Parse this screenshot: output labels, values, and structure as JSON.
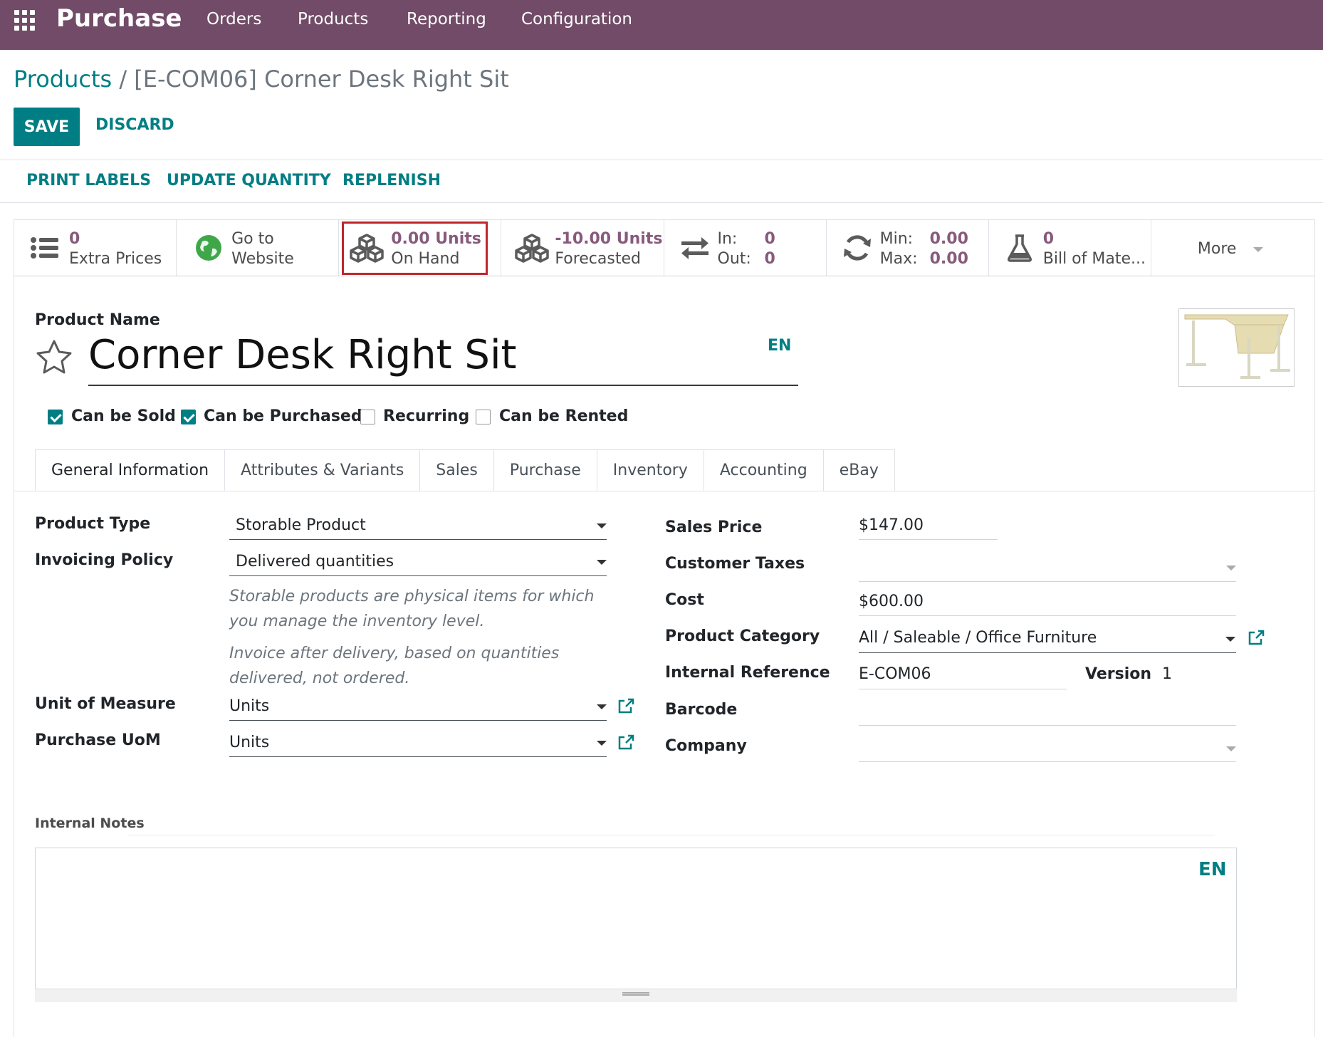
{
  "navbar": {
    "app_name": "Purchase",
    "menu": [
      "Orders",
      "Products",
      "Reporting",
      "Configuration"
    ],
    "color": "#714b67"
  },
  "breadcrumb": {
    "parent": "Products",
    "separator": "/",
    "current": "[E-COM06] Corner Desk Right Sit"
  },
  "form_buttons": {
    "save": "SAVE",
    "discard": "DISCARD"
  },
  "header_actions": [
    "PRINT LABELS",
    "UPDATE QUANTITY",
    "REPLENISH"
  ],
  "smart_buttons": {
    "extra_prices": {
      "value": "0",
      "label": "Extra Prices",
      "icon": "list-icon"
    },
    "website": {
      "line1": "Go to",
      "line2": "Website",
      "icon": "globe-icon"
    },
    "on_hand": {
      "value": "0.00 Units",
      "label": "On Hand",
      "icon": "cubes-icon"
    },
    "forecasted": {
      "value": "-10.00 Units",
      "label": "Forecasted",
      "icon": "cubes-icon"
    },
    "in_out": {
      "in_label": "In:",
      "in_value": "0",
      "out_label": "Out:",
      "out_value": "0",
      "icon": "exchange-icon"
    },
    "min_max": {
      "min_label": "Min:",
      "min_value": "0.00",
      "max_label": "Max:",
      "max_value": "0.00",
      "icon": "refresh-icon"
    },
    "bom": {
      "value": "0",
      "label": "Bill of Mate...",
      "icon": "flask-icon"
    },
    "more": "More"
  },
  "product": {
    "name_label": "Product Name",
    "name": "Corner Desk Right Sit",
    "lang": "EN",
    "options": [
      {
        "label": "Can be Sold",
        "checked": true
      },
      {
        "label": "Can be Purchased",
        "checked": true
      },
      {
        "label": "Recurring",
        "checked": false
      },
      {
        "label": "Can be Rented",
        "checked": false
      }
    ]
  },
  "tabs": [
    "General Information",
    "Attributes & Variants",
    "Sales",
    "Purchase",
    "Inventory",
    "Accounting",
    "eBay"
  ],
  "general": {
    "product_type": {
      "label": "Product Type",
      "value": "Storable Product"
    },
    "invoicing_policy": {
      "label": "Invoicing Policy",
      "value": "Delivered quantities"
    },
    "help1": "Storable products are physical items for which you manage the inventory level.",
    "help2": "Invoice after delivery, based on quantities delivered, not ordered.",
    "uom": {
      "label": "Unit of Measure",
      "value": "Units"
    },
    "purchase_uom": {
      "label": "Purchase UoM",
      "value": "Units"
    },
    "sales_price": {
      "label": "Sales Price",
      "value": "$147.00"
    },
    "customer_taxes": {
      "label": "Customer Taxes",
      "value": ""
    },
    "cost": {
      "label": "Cost",
      "value": "$600.00"
    },
    "category": {
      "label": "Product Category",
      "value": "All / Saleable / Office Furniture"
    },
    "internal_ref": {
      "label": "Internal Reference",
      "value": "E-COM06"
    },
    "version": {
      "label": "Version",
      "value": "1"
    },
    "barcode": {
      "label": "Barcode",
      "value": ""
    },
    "company": {
      "label": "Company",
      "value": ""
    }
  },
  "notes": {
    "label": "Internal Notes",
    "lang": "EN"
  }
}
